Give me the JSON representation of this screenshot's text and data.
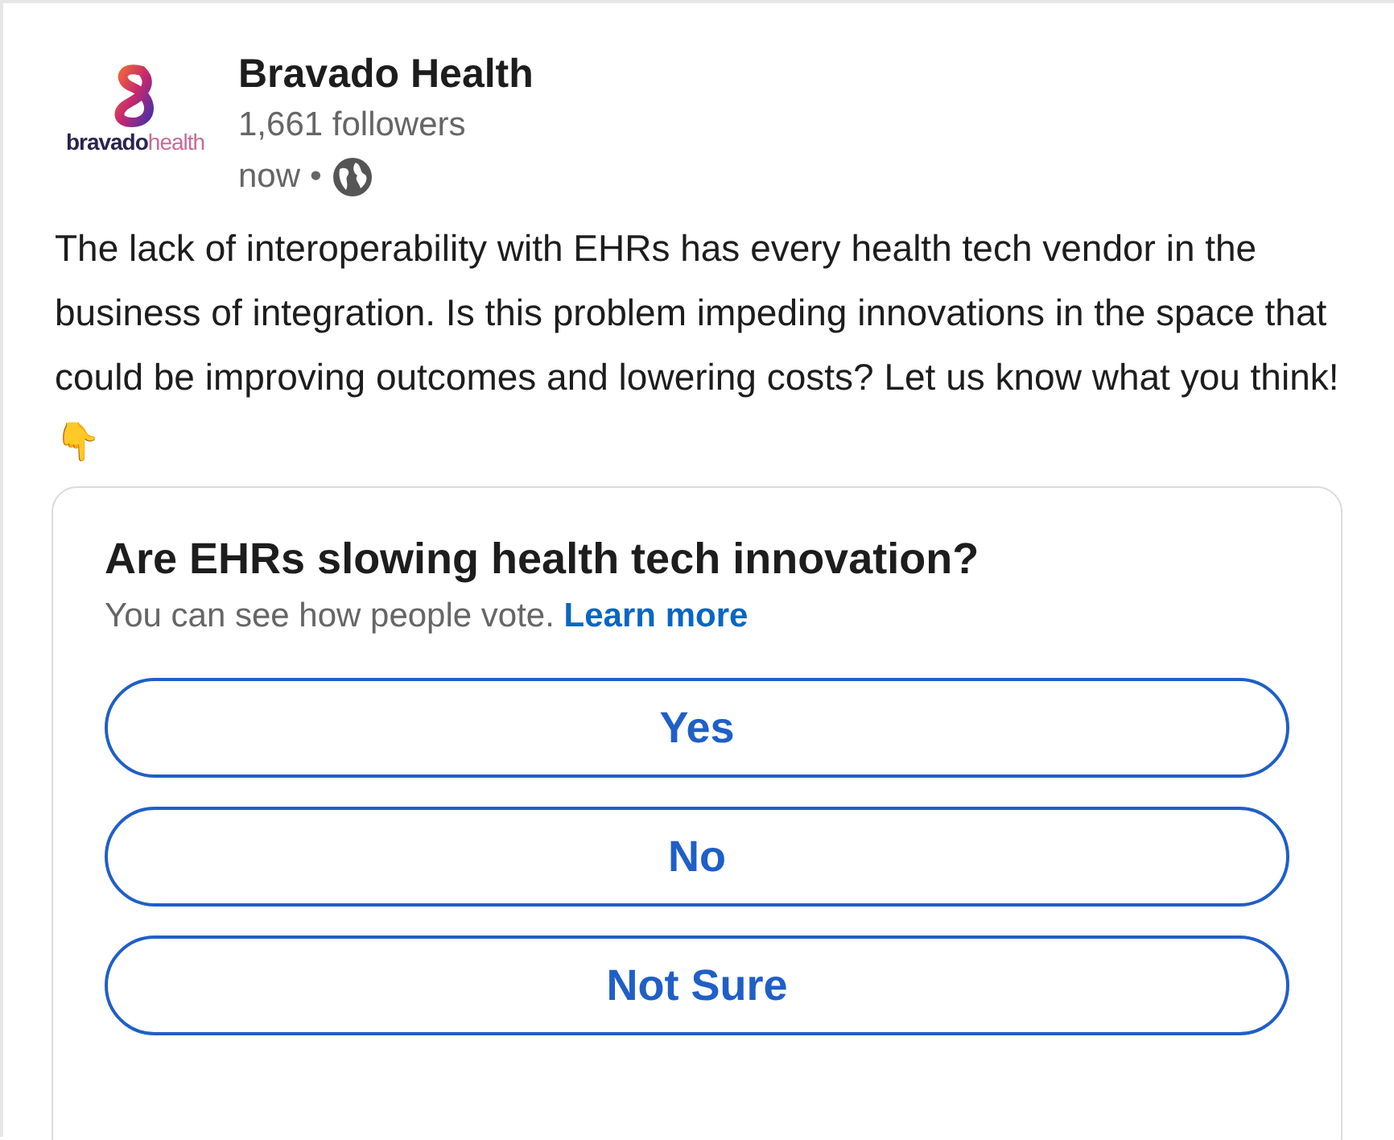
{
  "author": {
    "logo_word": "bravado",
    "logo_suffix": "health",
    "name": "Bravado Health",
    "followers": "1,661 followers",
    "time": "now",
    "separator": "•"
  },
  "body": "The lack of interoperability with EHRs has every health tech vendor in the business of integration. Is this problem impeding innovations in the space that could be improving outcomes and lowering costs? Let us know what you think!👇",
  "poll": {
    "question": "Are EHRs slowing health tech innovation?",
    "note": "You can see how people vote.",
    "link": "Learn more",
    "options": [
      {
        "label": "Yes"
      },
      {
        "label": "No"
      },
      {
        "label": "Not Sure"
      }
    ]
  }
}
